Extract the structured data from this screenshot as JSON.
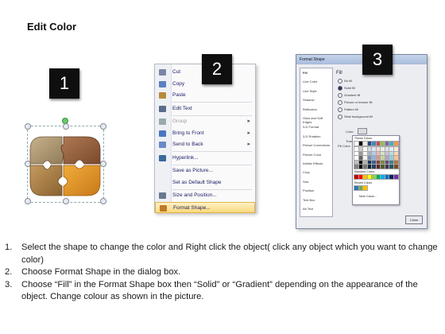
{
  "title": "Edit Color",
  "steps": [
    "1",
    "2",
    "3"
  ],
  "context_menu": {
    "items": [
      {
        "label": "Cut",
        "icon": "scissors-icon",
        "disabled": false,
        "submenu": false
      },
      {
        "label": "Copy",
        "icon": "copy-icon",
        "disabled": false,
        "submenu": false
      },
      {
        "label": "Paste",
        "icon": "paste-icon",
        "disabled": false,
        "submenu": false
      },
      {
        "label": "Edit Text",
        "icon": "edit-text-icon",
        "disabled": false,
        "submenu": false
      },
      {
        "label": "Group",
        "icon": "group-icon",
        "disabled": true,
        "submenu": true
      },
      {
        "label": "Bring to Front",
        "icon": "bring-front-icon",
        "disabled": false,
        "submenu": true
      },
      {
        "label": "Send to Back",
        "icon": "send-back-icon",
        "disabled": false,
        "submenu": true
      },
      {
        "label": "Hyperlink...",
        "icon": "hyperlink-icon",
        "disabled": false,
        "submenu": false
      },
      {
        "label": "Save as Picture...",
        "icon": "",
        "disabled": false,
        "submenu": false
      },
      {
        "label": "Set as Default Shape",
        "icon": "",
        "disabled": false,
        "submenu": false
      },
      {
        "label": "Size and Position...",
        "icon": "size-icon",
        "disabled": false,
        "submenu": false
      },
      {
        "label": "Format Shape...",
        "icon": "format-shape-icon",
        "disabled": false,
        "submenu": false,
        "highlighted": true
      }
    ],
    "accent_color": "#fbd97b"
  },
  "format_dialog": {
    "title": "Format Shape",
    "nav": [
      "Fill",
      "Line Color",
      "Line Style",
      "Shadow",
      "Reflection",
      "Glow and Soft Edges",
      "3-D Format",
      "3-D Rotation",
      "Picture Corrections",
      "Picture Color",
      "Artistic Effects",
      "Crop",
      "Size",
      "Position",
      "Text Box",
      "Alt Text"
    ],
    "section_label": "Fill",
    "options": [
      "No fill",
      "Solid fill",
      "Gradient fill",
      "Picture or texture fill",
      "Pattern fill",
      "Slide background fill"
    ],
    "fill_color_label": "Fill Color",
    "color_label": "Color:",
    "transparency_label": "Transparency:",
    "palette": {
      "theme_colors_label": "Theme Colors",
      "standard_colors_label": "Standard Colors",
      "recent_colors_label": "Recent Colors",
      "more_colors": "More Colors...",
      "theme_row": [
        "#ffffff",
        "#000000",
        "#eeece1",
        "#1f497d",
        "#4f81bd",
        "#c0504d",
        "#9bbb59",
        "#8064a2",
        "#4bacc6",
        "#f79646"
      ],
      "standard_row": [
        "#c00000",
        "#ff0000",
        "#ffc000",
        "#ffff00",
        "#92d050",
        "#00b050",
        "#00b0f0",
        "#0070c0",
        "#002060",
        "#7030a0"
      ]
    },
    "close_label": "Close"
  },
  "instructions": [
    {
      "num": "1.",
      "text": "Select the shape to change the color and Right click the object( click any object which you want to change color)"
    },
    {
      "num": "2.",
      "text": "Choose Format Shape in the dialog box."
    },
    {
      "num": "3.",
      "text": "Choose “Fill” in the Format Shape box then “Solid” or “Gradient” depending on the appearance of the object. Change colour as shown in the picture."
    }
  ]
}
